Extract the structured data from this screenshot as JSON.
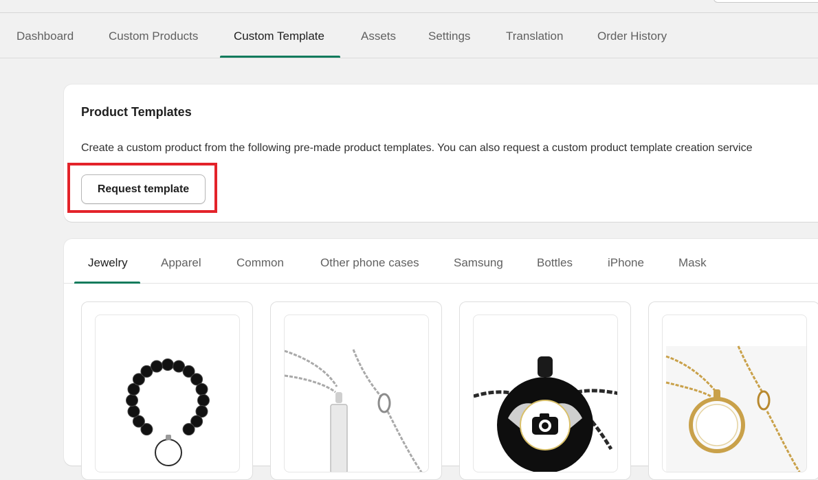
{
  "main_nav": {
    "tabs": [
      {
        "label": "Dashboard"
      },
      {
        "label": "Custom Products"
      },
      {
        "label": "Custom Template"
      },
      {
        "label": "Assets"
      },
      {
        "label": "Settings"
      },
      {
        "label": "Translation"
      },
      {
        "label": "Order History"
      }
    ],
    "active_index": 2
  },
  "templates_card": {
    "title": "Product Templates",
    "description": "Create a custom product from the following pre-made product templates. You can also request a custom product template creation service",
    "request_button": "Request template"
  },
  "catalog": {
    "tabs": [
      {
        "label": "Jewelry"
      },
      {
        "label": "Apparel"
      },
      {
        "label": "Common"
      },
      {
        "label": "Other phone cases"
      },
      {
        "label": "Samsung"
      },
      {
        "label": "Bottles"
      },
      {
        "label": "iPhone"
      },
      {
        "label": "Mask"
      }
    ],
    "active_index": 0,
    "products": [
      {
        "icon": "bead-bracelet-icon"
      },
      {
        "icon": "bar-necklace-icon"
      },
      {
        "icon": "photo-pendant-icon"
      },
      {
        "icon": "gold-locket-icon"
      }
    ]
  },
  "colors": {
    "accent": "#0f7b5c",
    "highlight": "#e3232a"
  }
}
